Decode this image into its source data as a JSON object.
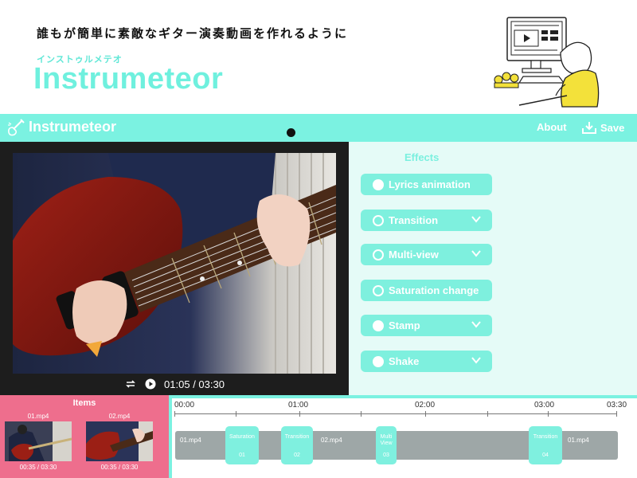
{
  "hero": {
    "tagline": "誰もが簡単に素敵なギター演奏動画を作れるように",
    "kana": "インストゥルメテオ",
    "title": "Instrumeteor"
  },
  "appbar": {
    "title": "Instrumeteor",
    "about": "About",
    "save": "Save",
    "icons": [
      "guitar-logo-icon",
      "download-icon"
    ]
  },
  "player": {
    "time": "01:05 / 03:30",
    "icons": [
      "loop-icon",
      "play-icon"
    ]
  },
  "effects": {
    "title": "Effects",
    "items": [
      {
        "label": "Lyrics animation",
        "selected": true,
        "expandable": false
      },
      {
        "label": "Transition",
        "selected": false,
        "expandable": true
      },
      {
        "label": "Multi-view",
        "selected": false,
        "expandable": true
      },
      {
        "label": "Saturation change",
        "selected": false,
        "expandable": false
      },
      {
        "label": "Stamp",
        "selected": true,
        "expandable": true
      },
      {
        "label": "Shake",
        "selected": true,
        "expandable": true
      }
    ]
  },
  "items": {
    "title": "Items",
    "list": [
      {
        "name": "01.mp4",
        "duration": "00:35 / 03:30"
      },
      {
        "name": "02.mp4",
        "duration": "00:35 / 03:30"
      }
    ]
  },
  "timeline": {
    "ticks": [
      "00:00",
      "01:00",
      "02:00",
      "03:00",
      "03:30"
    ],
    "clips": [
      "01.mp4",
      "02.mp4",
      "01.mp4"
    ],
    "transitions": [
      {
        "name": "Saturation",
        "num": "01"
      },
      {
        "name": "Transition",
        "num": "02"
      },
      {
        "name": "Multi View",
        "num": "03"
      },
      {
        "name": "Transition",
        "num": "04"
      }
    ]
  },
  "colors": {
    "accent": "#7bf2e1",
    "panel": "#e5fbf7",
    "items_bg": "#ee6e8d",
    "player_bg": "#1d1d1d",
    "track": "#9ea7a7"
  }
}
